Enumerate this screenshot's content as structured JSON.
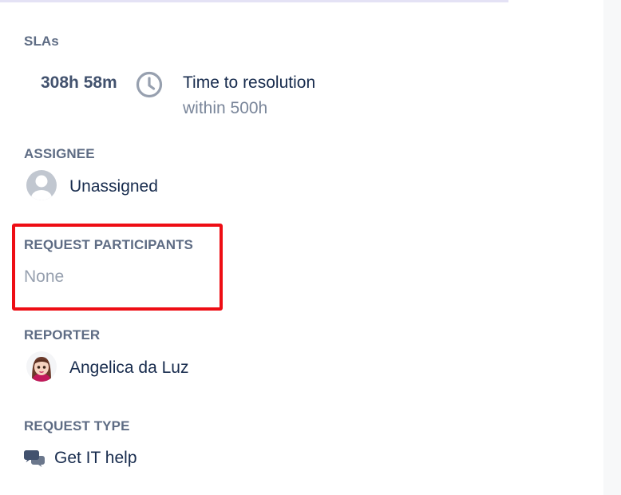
{
  "sla": {
    "label": "SLAs",
    "elapsed": "308h 58m",
    "goal": "Time to resolution",
    "target": "within 500h"
  },
  "assignee": {
    "label": "ASSIGNEE",
    "value": "Unassigned"
  },
  "participants": {
    "label": "REQUEST PARTICIPANTS",
    "value": "None"
  },
  "reporter": {
    "label": "REPORTER",
    "value": "Angelica da Luz"
  },
  "request_type": {
    "label": "REQUEST TYPE",
    "value": "Get IT help",
    "icon": "chat-bubbles-icon"
  },
  "colors": {
    "highlight": "#ee0d14",
    "label": "#5e6c84",
    "text": "#172b4d",
    "muted": "#7a869a"
  }
}
